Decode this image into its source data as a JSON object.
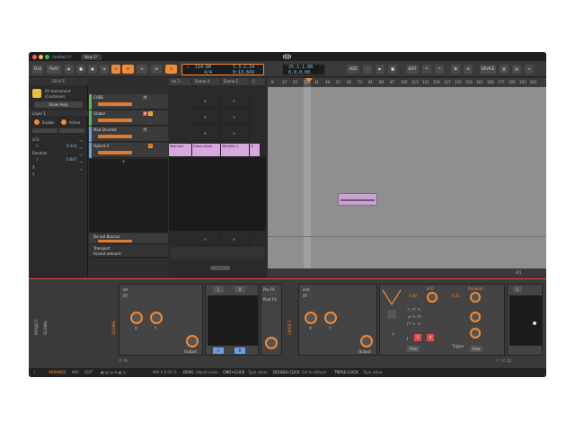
{
  "window": {
    "tabs": [
      "Untitled 1*",
      "New 2*"
    ]
  },
  "toolbar": {
    "file": "FILE",
    "play": "PLAY",
    "tempo": "114.00",
    "signature": "4/4",
    "position_bars": "7.3.2.24",
    "position_time": "0:13.849",
    "loop_start": "25.1.1.00",
    "loop_length": "8.0.0.00",
    "add": "ADD",
    "edit": "EDIT",
    "device": "DEVICE"
  },
  "device_panel": {
    "header": "DEVICE",
    "device_name": "XY Instrument",
    "device_type": "(Container)",
    "show_help": "Show Help",
    "layer": "Layer 1",
    "enable": "Enable",
    "active": "Active",
    "mods": [
      {
        "label": "LFO",
        "sub": "X",
        "value": "0.314"
      },
      {
        "label": "Random",
        "sub": "X",
        "value": "0.607"
      },
      {
        "label": "X",
        "sub": "",
        "value": ""
      },
      {
        "label": "Y",
        "sub": "",
        "value": ""
      }
    ]
  },
  "tracks": [
    {
      "name": "CUBE",
      "color": "#4fbf5a"
    },
    {
      "name": "Global",
      "color": "#4fbf5a"
    },
    {
      "name": "Mod Drumkit",
      "color": "#6aa0e8"
    },
    {
      "name": "Hybrid 4",
      "color": "#6aa0e8"
    }
  ],
  "bottom_tracks": {
    "name": "Do not Bounce",
    "transport": "Transport",
    "accent": "Accent amount"
  },
  "scenes": [
    "ne 3",
    "Scene 4",
    "Scene 5",
    "1"
  ],
  "clips": [
    "Wolf-boo",
    "Drops-beats",
    "WittyMix-1",
    "D"
  ],
  "ruler": [
    "9",
    "17",
    "25",
    "33",
    "41",
    "49",
    "57",
    "65",
    "73",
    "81",
    "89",
    "97",
    "105",
    "113",
    "121",
    "129",
    "137",
    "145",
    "153",
    "161",
    "169",
    "177",
    "185",
    "193",
    "201"
  ],
  "page_indicator": "4/1",
  "chain": {
    "project": "PROJECT",
    "global": "GLOBAL",
    "layer": "LAYER 1",
    "preset_a": "src",
    "preset_b": "inst",
    "xy": "XY",
    "knob_x": "X",
    "knob_y": "Y",
    "output": "Output",
    "pads": [
      "C",
      "D",
      "A",
      "B"
    ],
    "pre_fx": "Pre FX",
    "post_fx": "Post FX",
    "lfo": "LFO",
    "lfo_value": "2.80",
    "random": "Random",
    "random_value": "0.31",
    "free": "Free",
    "trigger": "Trigger",
    "mod_values": [
      "1",
      "4"
    ]
  },
  "status": {
    "arrange": "ARRANGE",
    "mix": "MIX",
    "edit": "EDIT",
    "mix_info": "MIX X  0:00 %",
    "drag": "DRAG",
    "drag_desc": "Adjust value",
    "cmd_click": "CMD+CLICK",
    "cmd_desc": "Type value",
    "double_click": "DOUBLE-CLICK",
    "double_desc": "Set to default",
    "triple_click": "TRIPLE-CLICK",
    "triple_desc": "Type value"
  },
  "colors": {
    "accent": "#f48a32",
    "clip": "#d9a7e0",
    "lcd_text": "#7fc8f0",
    "chain_border": "#e24a4a"
  }
}
